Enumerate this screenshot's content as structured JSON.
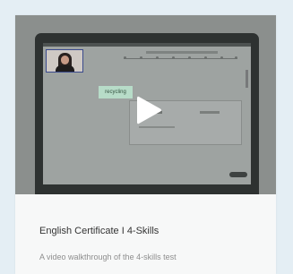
{
  "card": {
    "title": "English Certificate I 4-Skills",
    "description": "A video walkthrough of the 4-skills test"
  },
  "video": {
    "word_chip": "recycling",
    "play_icon": "play-icon",
    "colors": {
      "overlay": "#8b8f8d",
      "play": "#ffffff",
      "chip": "#b7dcc8",
      "page_bg": "#e4eef4"
    }
  }
}
